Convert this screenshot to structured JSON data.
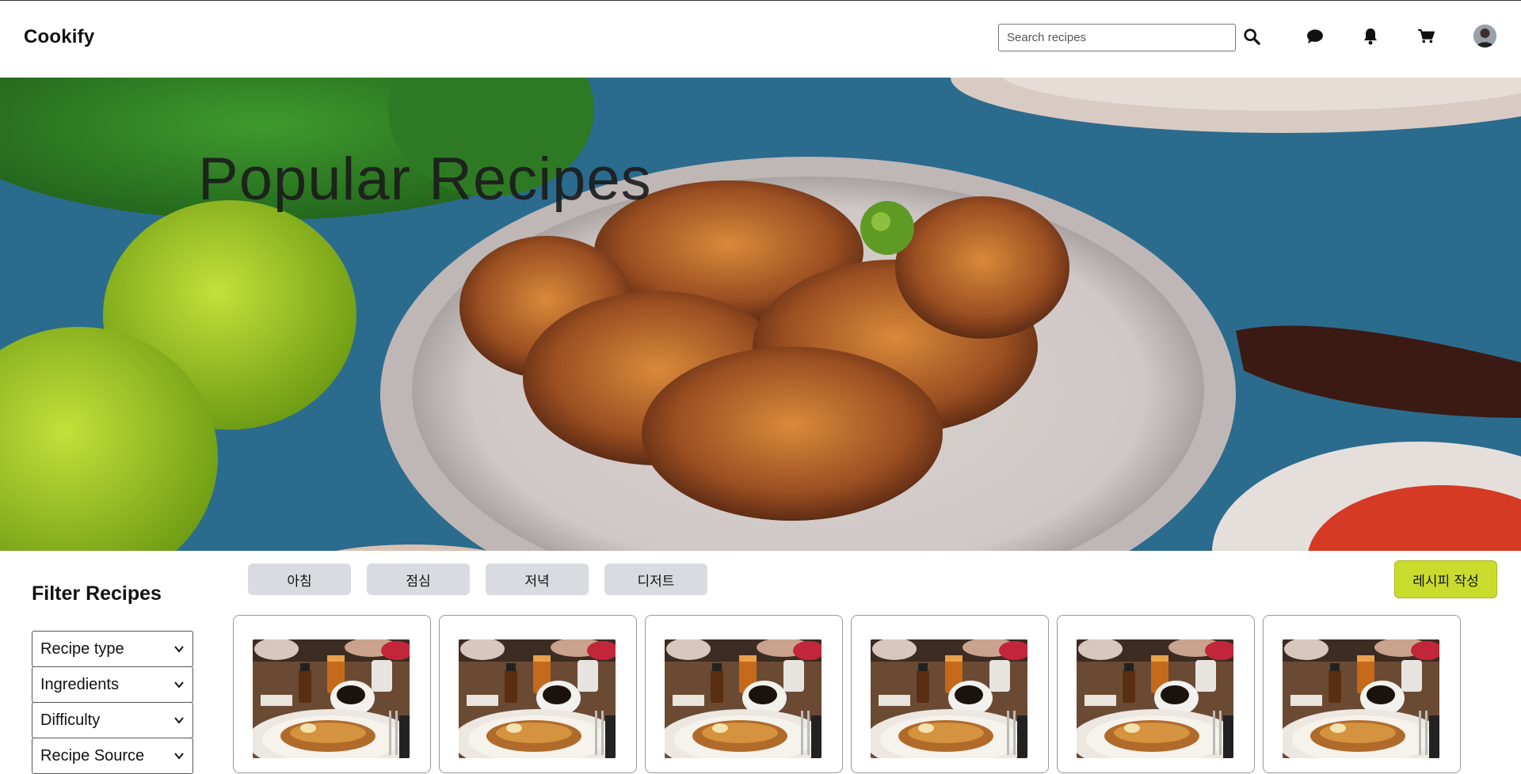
{
  "app": {
    "logo": "Cookify"
  },
  "header": {
    "search_placeholder": "Search recipes",
    "icons": [
      "search-icon",
      "chat-icon",
      "bell-icon",
      "cart-icon",
      "avatar"
    ]
  },
  "hero": {
    "title": "Popular Recipes"
  },
  "filters": {
    "title": "Filter Recipes",
    "selects": [
      {
        "label": "Recipe type"
      },
      {
        "label": "Ingredients"
      },
      {
        "label": "Difficulty"
      },
      {
        "label": "Recipe Source"
      }
    ]
  },
  "categories": {
    "tabs": [
      {
        "label": "아침"
      },
      {
        "label": "점심"
      },
      {
        "label": "저녁"
      },
      {
        "label": "디저트"
      }
    ],
    "write_button": "레시피 작성"
  },
  "recipes": {
    "cards": [
      {
        "image": "breakfast-photo"
      },
      {
        "image": "breakfast-photo"
      },
      {
        "image": "breakfast-photo"
      },
      {
        "image": "breakfast-photo"
      },
      {
        "image": "breakfast-photo"
      },
      {
        "image": "breakfast-photo"
      }
    ]
  },
  "colors": {
    "accent": "#c9dc2e",
    "tab_bg": "#d9dbe0",
    "hero_bg": "#2d6f93"
  }
}
